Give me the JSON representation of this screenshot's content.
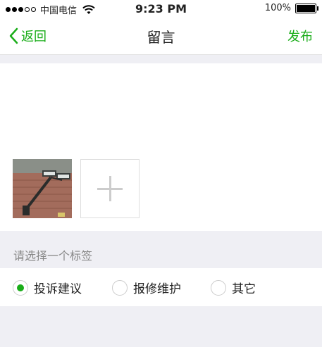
{
  "status_bar": {
    "carrier": "中国电信",
    "time": "9:23 PM",
    "battery": "100%"
  },
  "nav": {
    "back_label": "返回",
    "title": "留言",
    "publish_label": "发布"
  },
  "editor": {
    "content": ""
  },
  "tag_section": {
    "label": "请选择一个标签",
    "options": [
      {
        "label": "投诉建议",
        "selected": true
      },
      {
        "label": "报修维护",
        "selected": false
      },
      {
        "label": "其它",
        "selected": false
      }
    ]
  },
  "colors": {
    "accent": "#1aad19",
    "background": "#efeff4"
  }
}
